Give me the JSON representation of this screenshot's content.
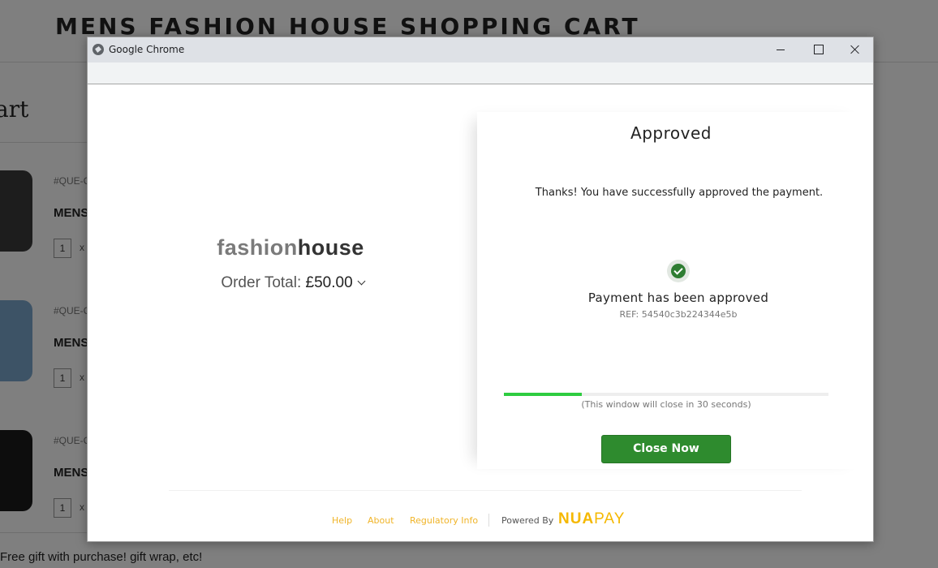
{
  "background": {
    "store_title": "MENS FASHION HOUSE SHOPPING CART",
    "cart_heading": "art",
    "items": [
      {
        "code": "#QUE-C",
        "name": "MENS",
        "qty": "1",
        "x": "x",
        "color": "#3a3a3a"
      },
      {
        "code": "#QUE-C",
        "name": "MENS",
        "qty": "1",
        "x": "x",
        "color": "#7ba6cc"
      },
      {
        "code": "#QUE-C",
        "name": "MENS",
        "qty": "1",
        "x": "x",
        "color": "#1a1a1a"
      }
    ],
    "footer_text": "Free gift with purchase! gift wrap, etc!"
  },
  "window": {
    "title": "Google Chrome",
    "icon": "globe-icon"
  },
  "merchant": {
    "brand_part1": "fashion",
    "brand_part2": "house",
    "order_total_label": "Order Total:",
    "order_total_amount": "£50.00"
  },
  "status": {
    "title": "Approved",
    "thanks": "Thanks! You have successfully approved the payment.",
    "icon": "check-circle-icon",
    "approved_text": "Payment has been approved",
    "reference": "REF: 54540c3b224344e5b",
    "countdown": "(This window will close in 30 seconds)",
    "progress": 0.24,
    "close_button": "Close Now"
  },
  "footer": {
    "help": "Help",
    "about": "About",
    "regulatory": "Regulatory Info",
    "powered_by": "Powered By",
    "logo_nua": "NUA",
    "logo_pay": "PAY"
  },
  "colors": {
    "accent_green": "#2e8b2e",
    "progress_green": "#2ecc40",
    "link_yellow": "#f0b428",
    "logo_yellow": "#f5b800"
  }
}
